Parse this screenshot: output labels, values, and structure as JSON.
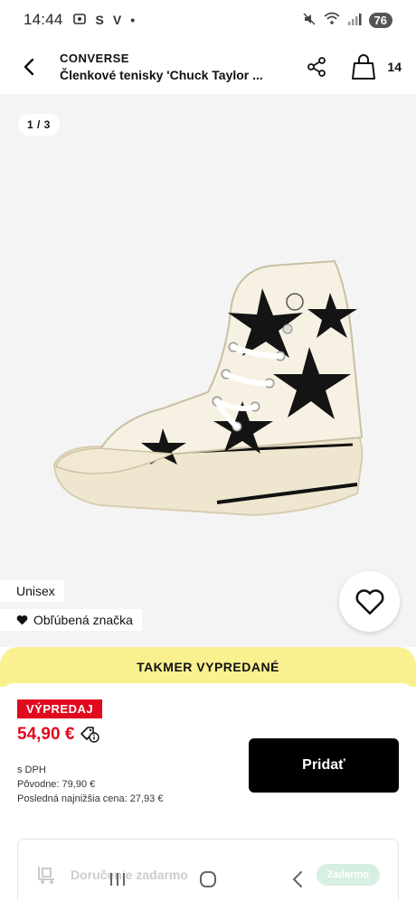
{
  "status_bar": {
    "time": "14:44",
    "icon_labels": [
      "S",
      "V",
      "•"
    ],
    "battery": "76"
  },
  "header": {
    "brand": "CONVERSE",
    "product_title": "Členkové tenisky 'Chuck Taylor ...",
    "bag_count": "14"
  },
  "gallery": {
    "pager": "1 / 3"
  },
  "tags": {
    "unisex": "Unisex",
    "favorite_brand": "Obľúbená značka"
  },
  "scarcity_banner": "TAKMER VYPREDANÉ",
  "purchase": {
    "sale_badge": "VÝPREDAJ",
    "price": "54,90 €",
    "vat_note": "s DPH",
    "original_price": "Pôvodne: 79,90 €",
    "lowest_price": "Posledná najnižšia cena:  27,93 €",
    "add_button": "Pridať"
  },
  "delivery": {
    "label": "Doručenie zadarmo",
    "pill": "Zadarmo"
  },
  "colors": {
    "accent_red": "#e10a1e",
    "scarcity_yellow": "#f9f190",
    "button_black": "#000000"
  }
}
